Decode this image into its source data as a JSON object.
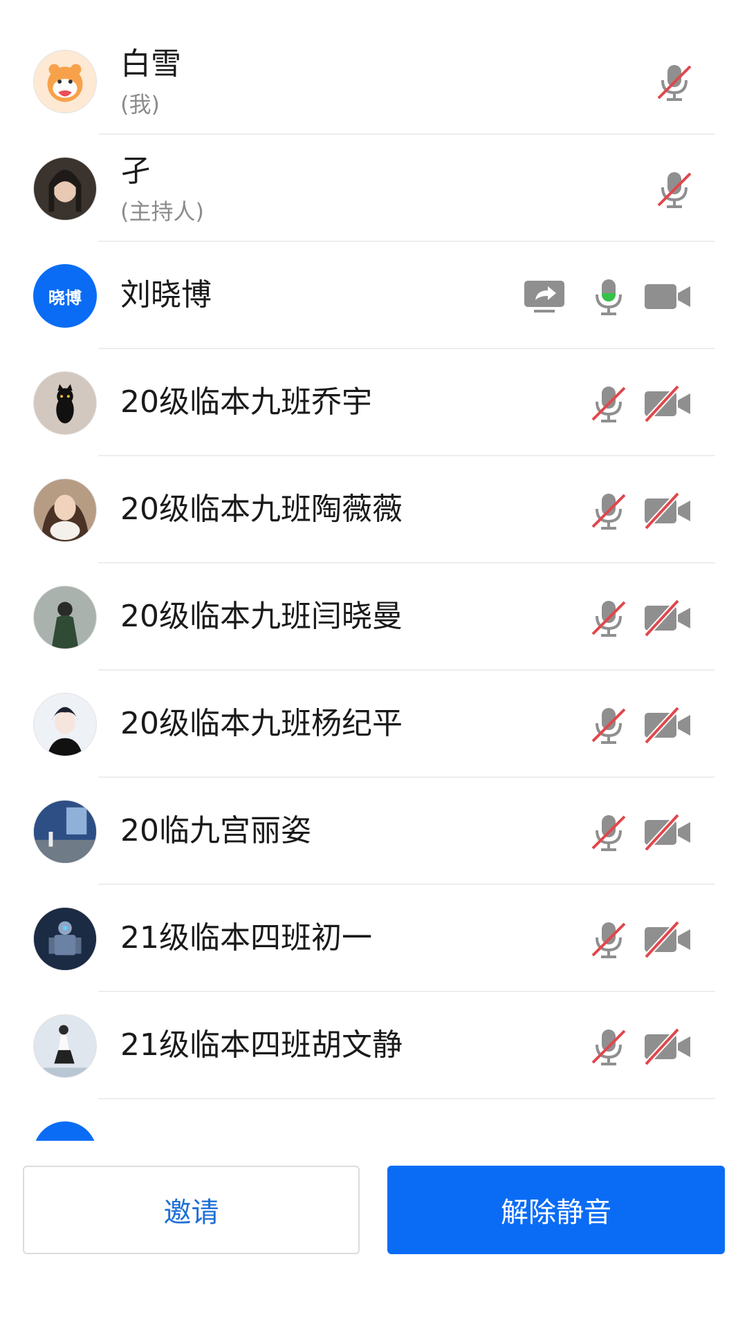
{
  "participants": [
    {
      "name": "白雪",
      "sub": "(我)",
      "avatar_icon": "tiger-cartoon-avatar",
      "mic": "muted",
      "camera": null,
      "sharing": false
    },
    {
      "name": "孑",
      "sub": "(主持人)",
      "avatar_icon": "girl-photo-avatar",
      "mic": "muted",
      "camera": null,
      "sharing": false
    },
    {
      "name": "刘晓博",
      "avatar_text": "晓博",
      "avatar_color": "#0a6cf5",
      "mic": "active",
      "camera": "on",
      "sharing": true
    },
    {
      "name": "20级临本九班乔宇",
      "avatar_icon": "black-cat-avatar",
      "mic": "muted",
      "camera": "off",
      "sharing": false
    },
    {
      "name": "20级临本九班陶薇薇",
      "avatar_icon": "girl-with-cat-avatar",
      "mic": "muted",
      "camera": "off",
      "sharing": false
    },
    {
      "name": "20级临本九班闫晓曼",
      "avatar_icon": "girl-photo-avatar",
      "mic": "muted",
      "camera": "off",
      "sharing": false
    },
    {
      "name": "20级临本九班杨纪平",
      "avatar_icon": "anime-boy-avatar",
      "mic": "muted",
      "camera": "off",
      "sharing": false
    },
    {
      "name": "20临九宫丽姿",
      "avatar_icon": "street-photo-avatar",
      "mic": "muted",
      "camera": "off",
      "sharing": false
    },
    {
      "name": "21级临本四班初一",
      "avatar_icon": "robot-avatar",
      "mic": "muted",
      "camera": "off",
      "sharing": false
    },
    {
      "name": "21级临本四班胡文静",
      "avatar_icon": "dancer-photo-avatar",
      "mic": "muted",
      "camera": "off",
      "sharing": false
    }
  ],
  "footer": {
    "invite_label": "邀请",
    "unmute_label": "解除静音"
  },
  "colors": {
    "accent": "#0a6cf5",
    "muted_slash": "#e0474c",
    "active_mic": "#35c24a",
    "icon_gray": "#8f8f8f"
  }
}
